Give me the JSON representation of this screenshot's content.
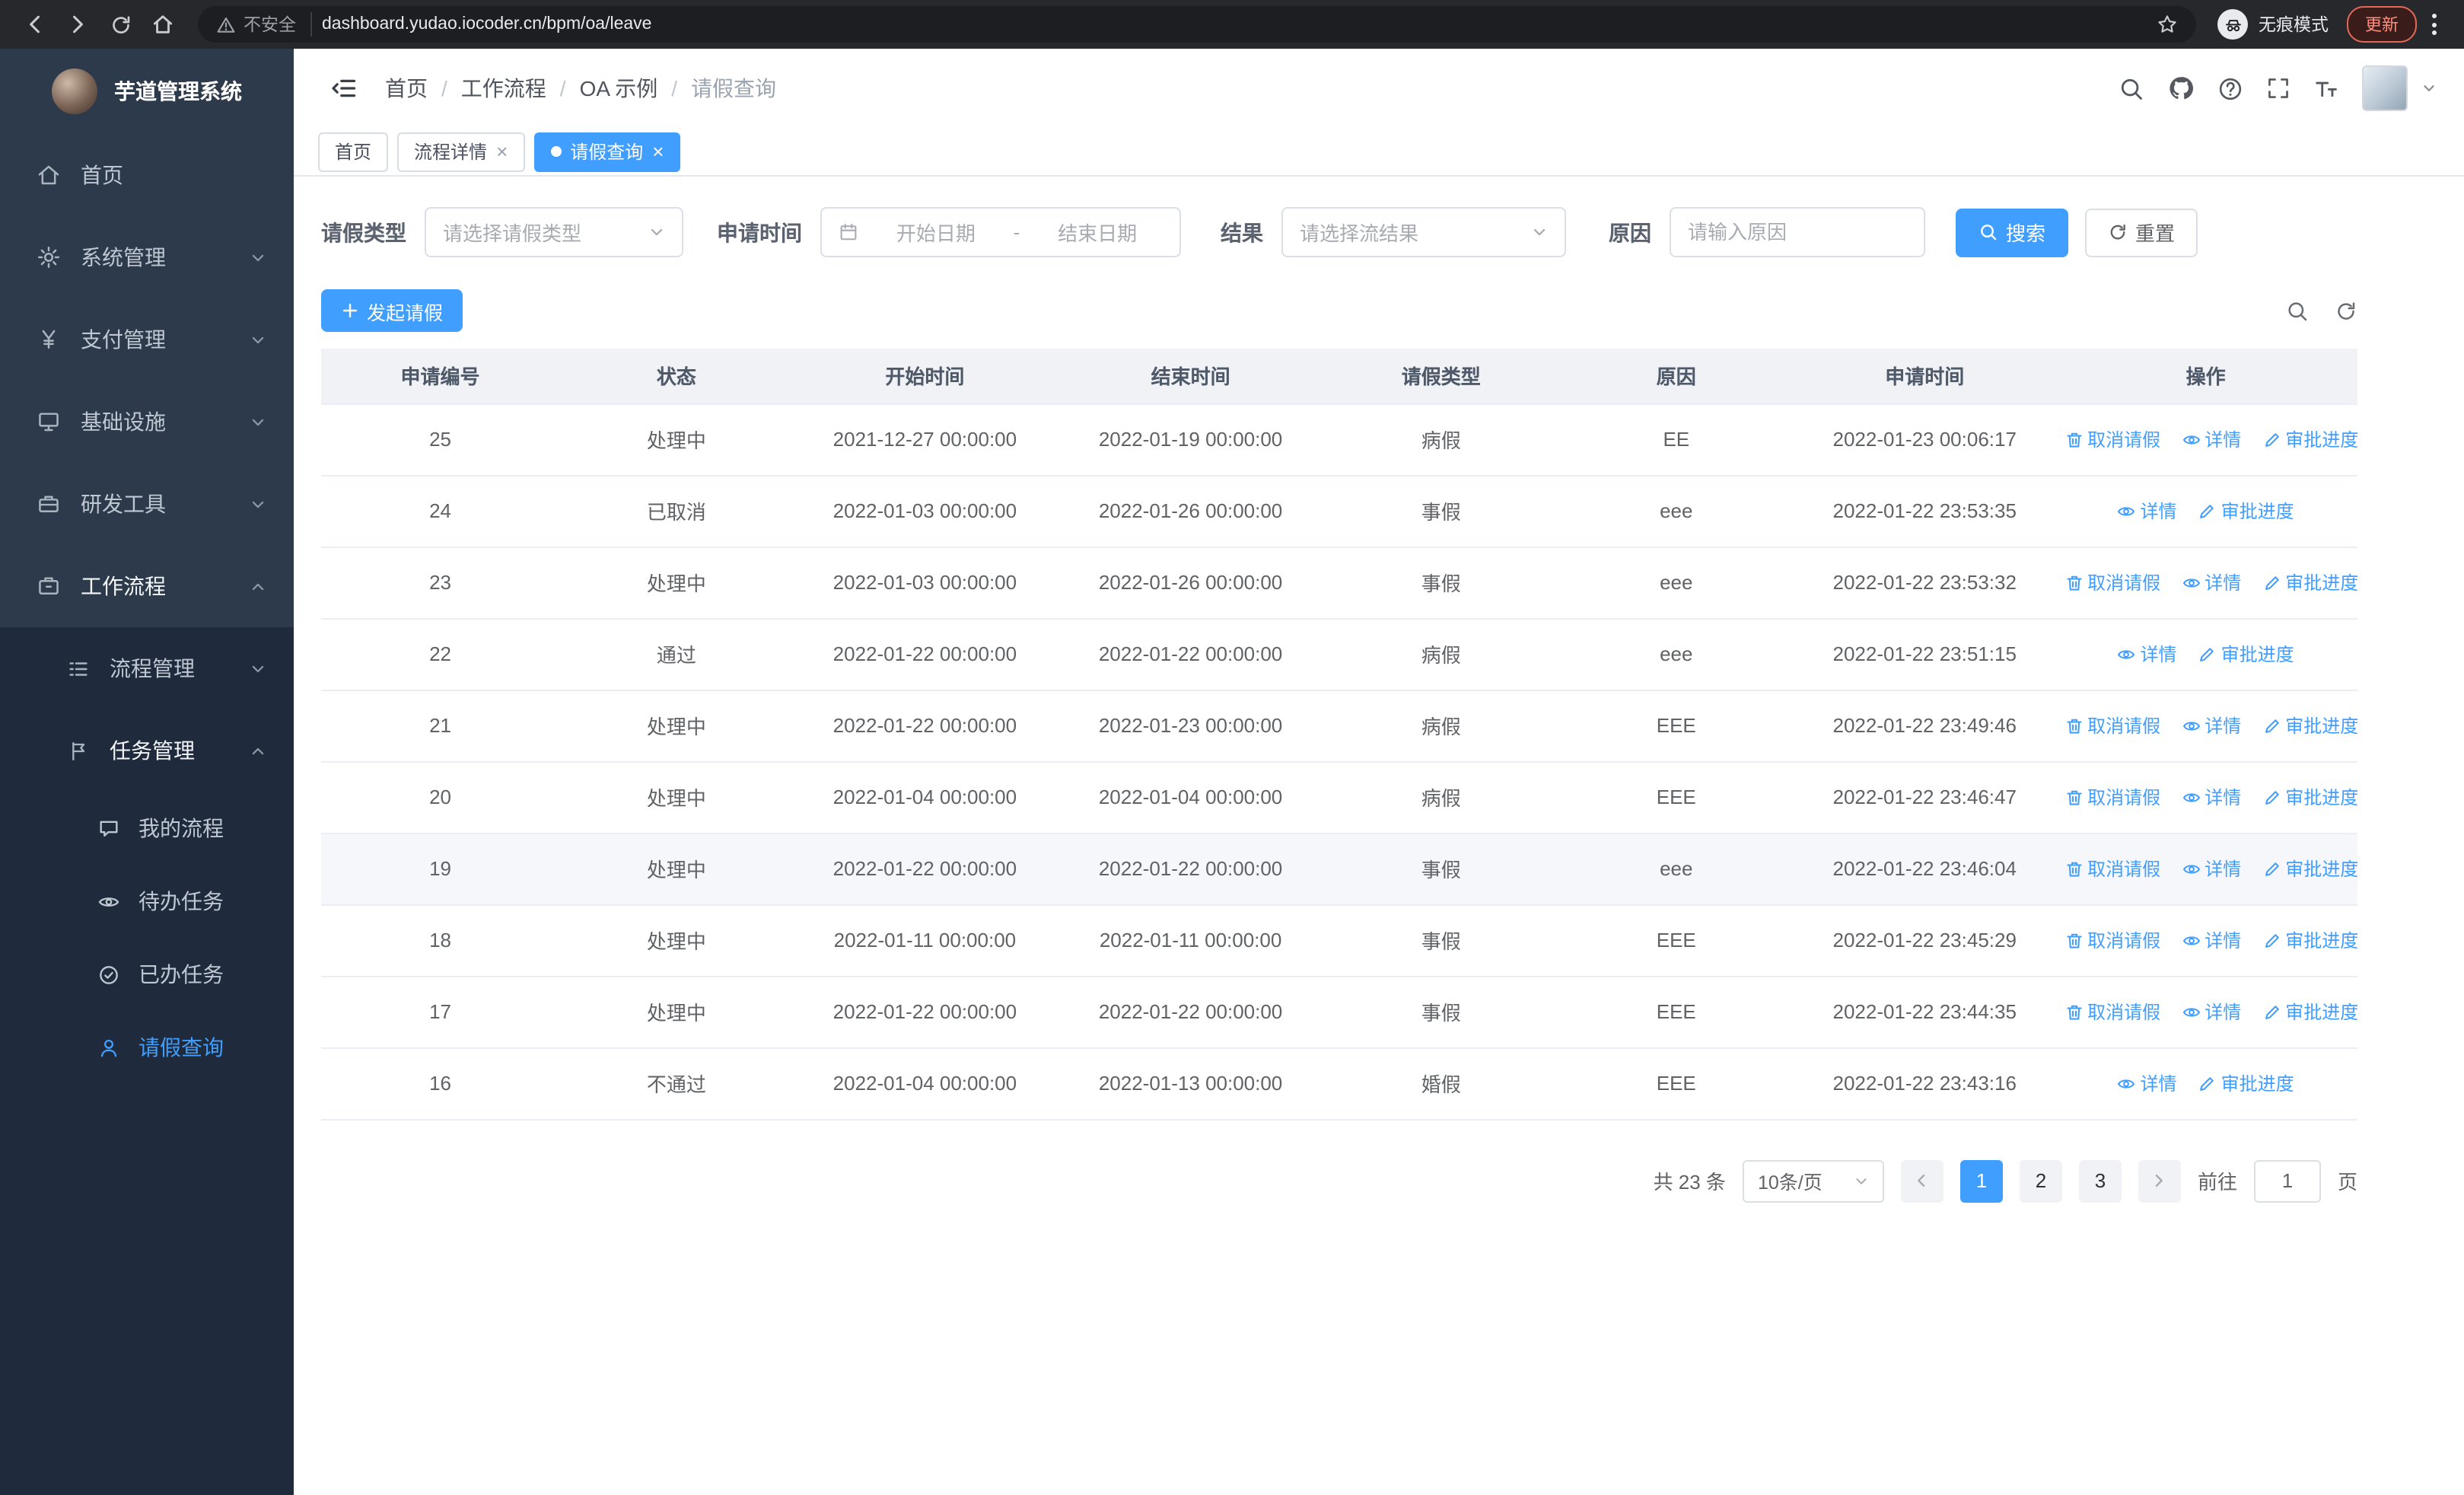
{
  "browser": {
    "security_label": "不安全",
    "url": "dashboard.yudao.iocoder.cn/bpm/oa/leave",
    "incognito_label": "无痕模式",
    "update_label": "更新"
  },
  "sidebar": {
    "title": "芋道管理系统",
    "items": [
      {
        "label": "首页",
        "icon": "home-icon"
      },
      {
        "label": "系统管理",
        "icon": "gear-icon"
      },
      {
        "label": "支付管理",
        "icon": "payment-icon"
      },
      {
        "label": "基础设施",
        "icon": "infrastructure-icon"
      },
      {
        "label": "研发工具",
        "icon": "devtools-icon"
      },
      {
        "label": "工作流程",
        "icon": "workflow-icon"
      }
    ],
    "submenu": {
      "process_label": "流程管理",
      "task_label": "任务管理",
      "task_children": [
        {
          "label": "我的流程",
          "icon": "my-process-icon"
        },
        {
          "label": "待办任务",
          "icon": "todo-task-icon"
        },
        {
          "label": "已办任务",
          "icon": "done-task-icon"
        },
        {
          "label": "请假查询",
          "icon": "leave-query-icon",
          "active": true
        }
      ]
    }
  },
  "header": {
    "breadcrumb": [
      "首页",
      "工作流程",
      "OA 示例",
      "请假查询"
    ]
  },
  "tabs": [
    {
      "label": "首页"
    },
    {
      "label": "流程详情",
      "closable": true
    },
    {
      "label": "请假查询",
      "closable": true,
      "active": true
    }
  ],
  "filters": {
    "leave_type_label": "请假类型",
    "leave_type_placeholder": "请选择请假类型",
    "apply_time_label": "申请时间",
    "start_date_placeholder": "开始日期",
    "range_separator": "-",
    "end_date_placeholder": "结束日期",
    "result_label": "结果",
    "result_placeholder": "请选择流结果",
    "reason_label": "原因",
    "reason_placeholder": "请输入原因",
    "search_label": "搜索",
    "reset_label": "重置"
  },
  "toolbar": {
    "create_label": "发起请假"
  },
  "table": {
    "columns": [
      "申请编号",
      "状态",
      "开始时间",
      "结束时间",
      "请假类型",
      "原因",
      "申请时间",
      "操作"
    ],
    "rows": [
      {
        "id": "25",
        "status": "处理中",
        "start": "2021-12-27 00:00:00",
        "end": "2022-01-19 00:00:00",
        "type": "病假",
        "reason": "EE",
        "applied": "2022-01-23 00:06:17",
        "actions": [
          {
            "label": "取消请假",
            "icon": "cancel-icon",
            "name": "cancel-leave-action"
          },
          {
            "label": "详情",
            "icon": "view-icon",
            "name": "detail-action"
          },
          {
            "label": "审批进度",
            "icon": "progress-icon",
            "name": "approval-progress-action"
          }
        ]
      },
      {
        "id": "24",
        "status": "已取消",
        "start": "2022-01-03 00:00:00",
        "end": "2022-01-26 00:00:00",
        "type": "事假",
        "reason": "eee",
        "applied": "2022-01-22 23:53:35",
        "actions": [
          {
            "label": "详情",
            "icon": "view-icon",
            "name": "detail-action"
          },
          {
            "label": "审批进度",
            "icon": "progress-icon",
            "name": "approval-progress-action"
          }
        ]
      },
      {
        "id": "23",
        "status": "处理中",
        "start": "2022-01-03 00:00:00",
        "end": "2022-01-26 00:00:00",
        "type": "事假",
        "reason": "eee",
        "applied": "2022-01-22 23:53:32",
        "actions": [
          {
            "label": "取消请假",
            "icon": "cancel-icon",
            "name": "cancel-leave-action"
          },
          {
            "label": "详情",
            "icon": "view-icon",
            "name": "detail-action"
          },
          {
            "label": "审批进度",
            "icon": "progress-icon",
            "name": "approval-progress-action"
          }
        ]
      },
      {
        "id": "22",
        "status": "通过",
        "start": "2022-01-22 00:00:00",
        "end": "2022-01-22 00:00:00",
        "type": "病假",
        "reason": "eee",
        "applied": "2022-01-22 23:51:15",
        "actions": [
          {
            "label": "详情",
            "icon": "view-icon",
            "name": "detail-action"
          },
          {
            "label": "审批进度",
            "icon": "progress-icon",
            "name": "approval-progress-action"
          }
        ]
      },
      {
        "id": "21",
        "status": "处理中",
        "start": "2022-01-22 00:00:00",
        "end": "2022-01-23 00:00:00",
        "type": "病假",
        "reason": "EEE",
        "applied": "2022-01-22 23:49:46",
        "actions": [
          {
            "label": "取消请假",
            "icon": "cancel-icon",
            "name": "cancel-leave-action"
          },
          {
            "label": "详情",
            "icon": "view-icon",
            "name": "detail-action"
          },
          {
            "label": "审批进度",
            "icon": "progress-icon",
            "name": "approval-progress-action"
          }
        ]
      },
      {
        "id": "20",
        "status": "处理中",
        "start": "2022-01-04 00:00:00",
        "end": "2022-01-04 00:00:00",
        "type": "病假",
        "reason": "EEE",
        "applied": "2022-01-22 23:46:47",
        "actions": [
          {
            "label": "取消请假",
            "icon": "cancel-icon",
            "name": "cancel-leave-action"
          },
          {
            "label": "详情",
            "icon": "view-icon",
            "name": "detail-action"
          },
          {
            "label": "审批进度",
            "icon": "progress-icon",
            "name": "approval-progress-action"
          }
        ]
      },
      {
        "id": "19",
        "status": "处理中",
        "start": "2022-01-22 00:00:00",
        "end": "2022-01-22 00:00:00",
        "type": "事假",
        "reason": "eee",
        "applied": "2022-01-22 23:46:04",
        "hover": true,
        "actions": [
          {
            "label": "取消请假",
            "icon": "cancel-icon",
            "name": "cancel-leave-action"
          },
          {
            "label": "详情",
            "icon": "view-icon",
            "name": "detail-action"
          },
          {
            "label": "审批进度",
            "icon": "progress-icon",
            "name": "approval-progress-action"
          }
        ]
      },
      {
        "id": "18",
        "status": "处理中",
        "start": "2022-01-11 00:00:00",
        "end": "2022-01-11 00:00:00",
        "type": "事假",
        "reason": "EEE",
        "applied": "2022-01-22 23:45:29",
        "actions": [
          {
            "label": "取消请假",
            "icon": "cancel-icon",
            "name": "cancel-leave-action"
          },
          {
            "label": "详情",
            "icon": "view-icon",
            "name": "detail-action"
          },
          {
            "label": "审批进度",
            "icon": "progress-icon",
            "name": "approval-progress-action"
          }
        ]
      },
      {
        "id": "17",
        "status": "处理中",
        "start": "2022-01-22 00:00:00",
        "end": "2022-01-22 00:00:00",
        "type": "事假",
        "reason": "EEE",
        "applied": "2022-01-22 23:44:35",
        "actions": [
          {
            "label": "取消请假",
            "icon": "cancel-icon",
            "name": "cancel-leave-action"
          },
          {
            "label": "详情",
            "icon": "view-icon",
            "name": "detail-action"
          },
          {
            "label": "审批进度",
            "icon": "progress-icon",
            "name": "approval-progress-action"
          }
        ]
      },
      {
        "id": "16",
        "status": "不通过",
        "start": "2022-01-04 00:00:00",
        "end": "2022-01-13 00:00:00",
        "type": "婚假",
        "reason": "EEE",
        "applied": "2022-01-22 23:43:16",
        "actions": [
          {
            "label": "详情",
            "icon": "view-icon",
            "name": "detail-action"
          },
          {
            "label": "审批进度",
            "icon": "progress-icon",
            "name": "approval-progress-action"
          }
        ]
      }
    ]
  },
  "pagination": {
    "total_label": "共 23 条",
    "page_size": "10条/页",
    "pages": [
      "1",
      "2",
      "3"
    ],
    "current": "1",
    "goto_label": "前往",
    "goto_value": "1",
    "page_unit": "页"
  },
  "colors": {
    "accent": "#409eff",
    "sidebar_bg": "#2d3a4b",
    "submenu_bg": "#1f2b3c"
  }
}
